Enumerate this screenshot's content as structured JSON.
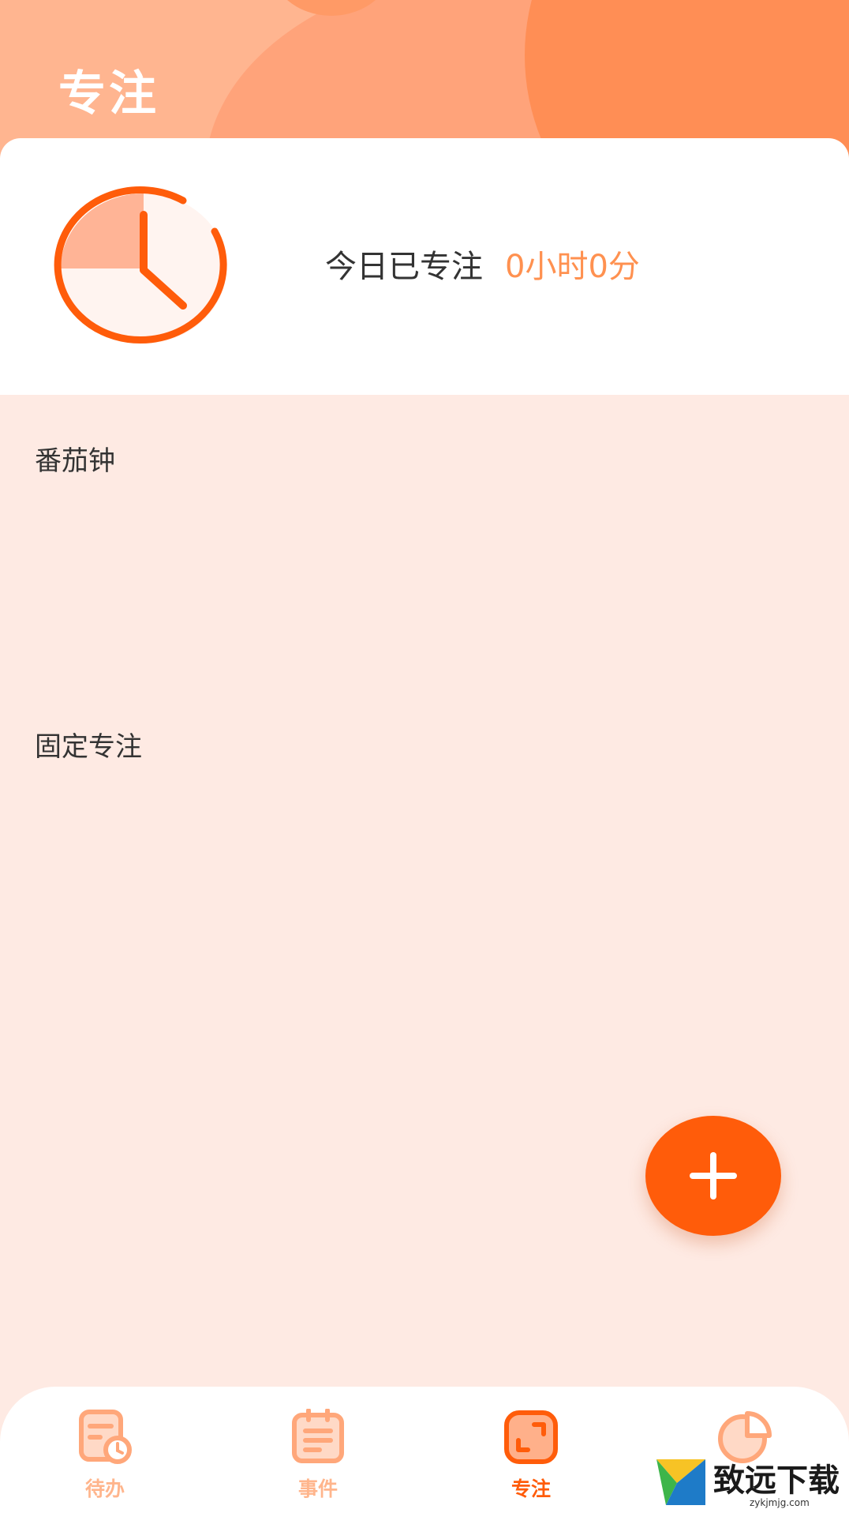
{
  "header": {
    "title": "专注"
  },
  "summary": {
    "label": "今日已专注",
    "value": "0小时0分"
  },
  "sections": {
    "pomodoro": "番茄钟",
    "fixed_focus": "固定专注"
  },
  "fab": {
    "icon": "plus-icon"
  },
  "nav": {
    "items": [
      {
        "label": "待办",
        "icon": "todo-clock-icon",
        "active": false
      },
      {
        "label": "事件",
        "icon": "clipboard-list-icon",
        "active": false
      },
      {
        "label": "专注",
        "icon": "focus-frame-icon",
        "active": true
      },
      {
        "label": "",
        "icon": "pie-chart-icon",
        "active": false
      }
    ]
  },
  "watermark": {
    "title": "致远下载",
    "url": "zykjmjg.com"
  },
  "colors": {
    "accent": "#FF5C0A",
    "accent_light": "#FF9150",
    "nav_inactive": "#FFB58C",
    "background": "#FEEAE3",
    "header": "#FFB590"
  }
}
